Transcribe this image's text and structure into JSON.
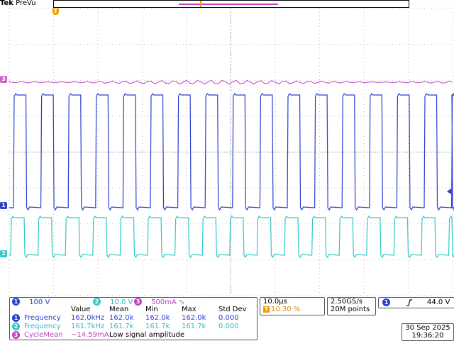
{
  "header": {
    "brand": "Tek",
    "mode": "PreVu",
    "trigger_marker_label": "T"
  },
  "channel_markers": {
    "ch1": "1",
    "ch2": "2",
    "ch3": "3"
  },
  "colors": {
    "ch1": "#2a3fd0",
    "ch2": "#30c8c8",
    "ch3": "#c040c0",
    "trigger": "#f0a000",
    "grid": "#bdbdbd"
  },
  "channels": [
    {
      "badge": "1",
      "scale": "100 V"
    },
    {
      "badge": "2",
      "scale": "10.0 V"
    },
    {
      "badge": "3",
      "scale": "500mA ∿"
    }
  ],
  "timebase": {
    "scale": "10.0μs",
    "trigger_position": "10.30 %"
  },
  "acquisition": {
    "sample_rate": "2.50GS/s",
    "record_length": "20M points"
  },
  "trigger": {
    "channel": "1",
    "slope_icon": "rising-edge-icon",
    "level": "44.0 V"
  },
  "measurements": {
    "headers": [
      "Value",
      "Mean",
      "Min",
      "Max",
      "Std Dev"
    ],
    "rows": [
      {
        "badge": "1",
        "name": "Frequency",
        "value": "162.0kHz",
        "mean": "162.0k",
        "min": "162.0k",
        "max": "162.0k",
        "stddev": "0.000"
      },
      {
        "badge": "2",
        "name": "Frequency",
        "value": "161.7kHz",
        "mean": "161.7k",
        "min": "161.7k",
        "max": "161.7k",
        "stddev": "0.000"
      },
      {
        "badge": "3",
        "name": "CycleMean",
        "value": "~14.59mA",
        "note": "Low signal amplitude"
      }
    ]
  },
  "datetime": {
    "date": "30 Sep  2025",
    "time": "19:36:20"
  }
}
